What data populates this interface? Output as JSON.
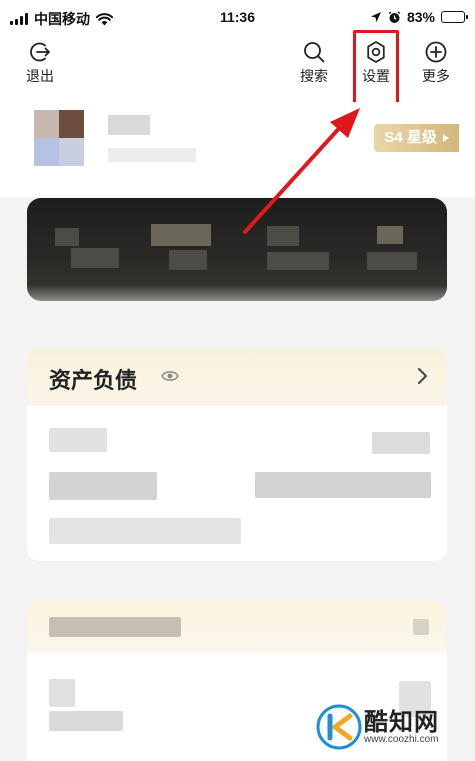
{
  "status_bar": {
    "carrier": "中国移动",
    "time": "11:36",
    "battery": "83%",
    "battery_level": 0.83
  },
  "header": {
    "logout_label": "退出",
    "search_label": "搜索",
    "settings_label": "设置",
    "more_label": "更多"
  },
  "profile": {
    "star_badge": "S4 星级"
  },
  "assets": {
    "title": "资产负债"
  },
  "watermark": {
    "brand": "酷知网",
    "url": "www.coozhi.com"
  },
  "colors": {
    "highlight": "#e0181c",
    "badge_gold": "#d4b67a",
    "card_header": "#f8f1dc"
  }
}
